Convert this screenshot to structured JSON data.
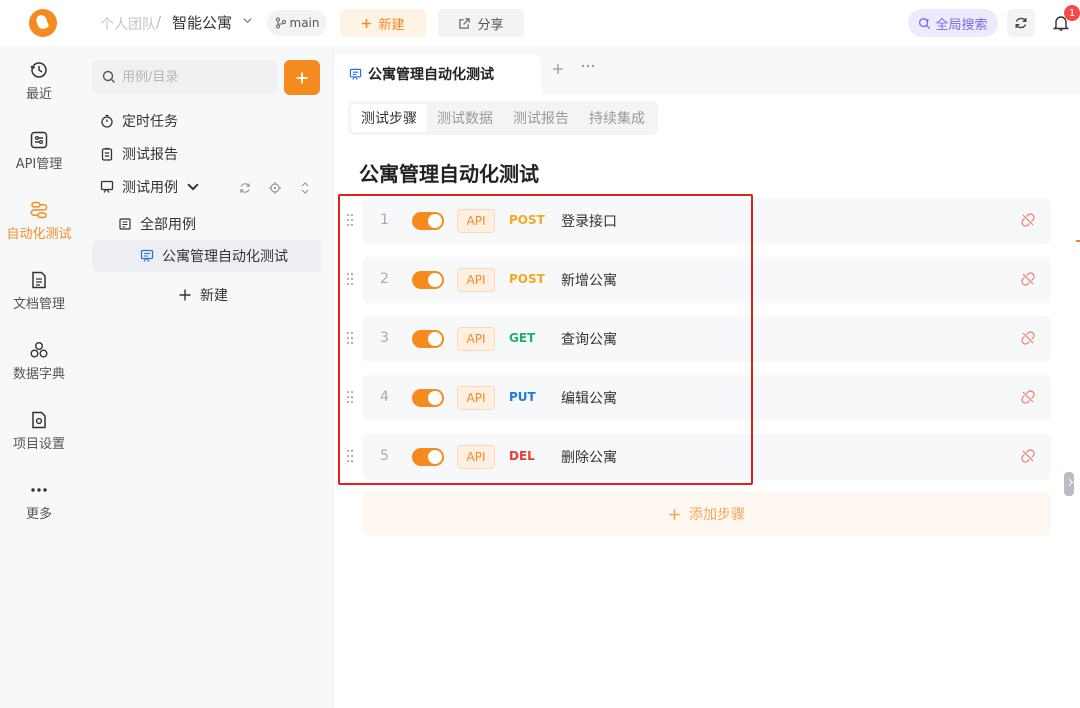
{
  "topbar": {
    "team": "个人团队",
    "separator": "/",
    "project": "智能公寓",
    "branch": "main",
    "new_label": "新建",
    "share_label": "分享",
    "global_search_label": "全局搜索",
    "notification_count": "1",
    "accent": "#f58a1f"
  },
  "rail": {
    "items": [
      {
        "label": "最近",
        "icon": "clock-history-icon"
      },
      {
        "label": "API管理",
        "icon": "api-manage-icon"
      },
      {
        "label": "自动化测试",
        "icon": "flow-icon",
        "active": true
      },
      {
        "label": "文档管理",
        "icon": "document-icon"
      },
      {
        "label": "数据字典",
        "icon": "data-dictionary-icon"
      },
      {
        "label": "项目设置",
        "icon": "settings-icon"
      },
      {
        "label": "更多",
        "icon": "more-icon"
      }
    ]
  },
  "tree": {
    "search_placeholder": "用例/目录",
    "items": [
      {
        "label": "定时任务",
        "icon": "timer-icon"
      },
      {
        "label": "测试报告",
        "icon": "clipboard-icon"
      },
      {
        "label": "测试用例",
        "icon": "testcase-icon",
        "expanded": true
      },
      {
        "label": "全部用例",
        "icon": "folder-icon"
      },
      {
        "label": "公寓管理自动化测试",
        "icon": "testcase-file-icon",
        "selected": true
      },
      {
        "label": "新建",
        "icon": "plus-icon"
      }
    ]
  },
  "main": {
    "doc_tab": "公寓管理自动化测试",
    "sub_tabs": [
      "测试步骤",
      "测试数据",
      "测试报告",
      "持续集成"
    ],
    "active_sub_tab": "测试步骤",
    "title": "公寓管理自动化测试",
    "steps": [
      {
        "num": "1",
        "type": "API",
        "method": "POST",
        "name": "登录接口",
        "enabled": true
      },
      {
        "num": "2",
        "type": "API",
        "method": "POST",
        "name": "新增公寓",
        "enabled": true
      },
      {
        "num": "3",
        "type": "API",
        "method": "GET",
        "name": "查询公寓",
        "enabled": true
      },
      {
        "num": "4",
        "type": "API",
        "method": "PUT",
        "name": "编辑公寓",
        "enabled": true
      },
      {
        "num": "5",
        "type": "API",
        "method": "DEL",
        "name": "删除公寓",
        "enabled": true
      }
    ],
    "method_colors": {
      "POST": "#f5a623",
      "GET": "#19b36b",
      "PUT": "#1f7ae0",
      "DEL": "#e53e2f"
    },
    "add_step_label": "添加步骤"
  }
}
